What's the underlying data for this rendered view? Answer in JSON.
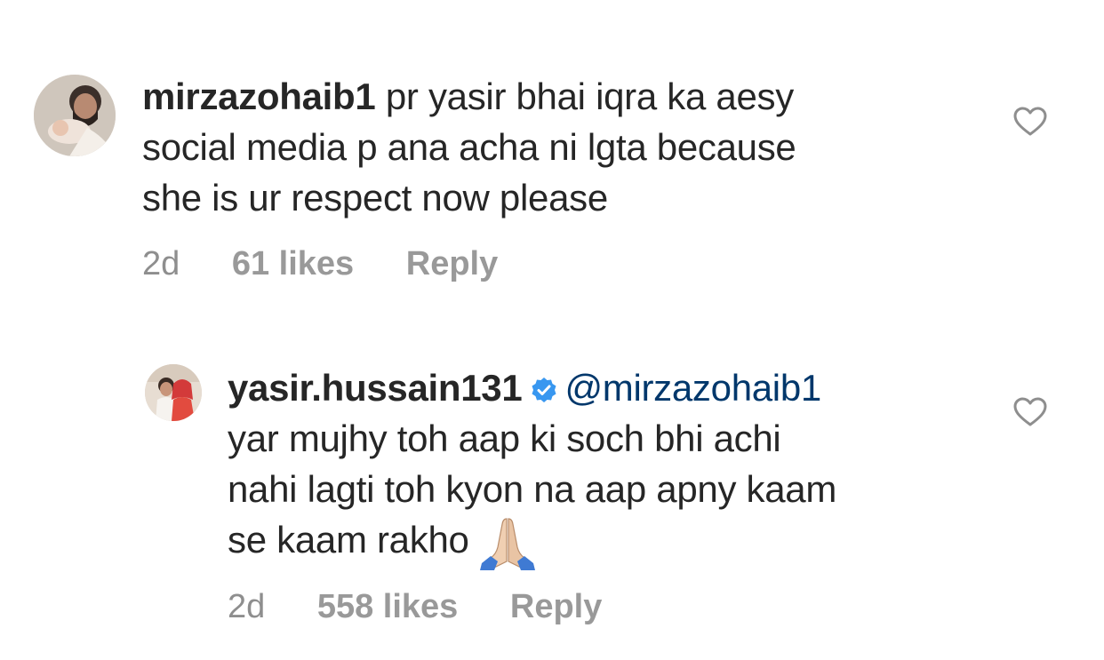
{
  "comments": [
    {
      "username": "mirzazohaib1",
      "verified": false,
      "mention": "",
      "lines": [
        " pr yasir bhai iqra ka aesy",
        "social media p ana acha ni lgta because",
        "she is ur respect now please"
      ],
      "time": "2d",
      "likes": "61 likes",
      "reply": "Reply",
      "avatar_icon": "profile-photo"
    },
    {
      "username": "yasir.hussain131",
      "verified": true,
      "mention": "@mirzazohaib1",
      "lines": [
        "yar mujhy toh aap ki soch bhi achi",
        "nahi lagti toh kyon na aap apny kaam",
        "se kaam rakho"
      ],
      "emoji": "folded-hands",
      "time": "2d",
      "likes": "558 likes",
      "reply": "Reply",
      "avatar_icon": "profile-photo"
    }
  ],
  "colors": {
    "text": "#262626",
    "meta": "#8e8e8e",
    "mention": "#00376b",
    "verified": "#3897f0"
  },
  "icons": {
    "like": "heart-outline-icon",
    "verified": "verified-badge-icon"
  }
}
